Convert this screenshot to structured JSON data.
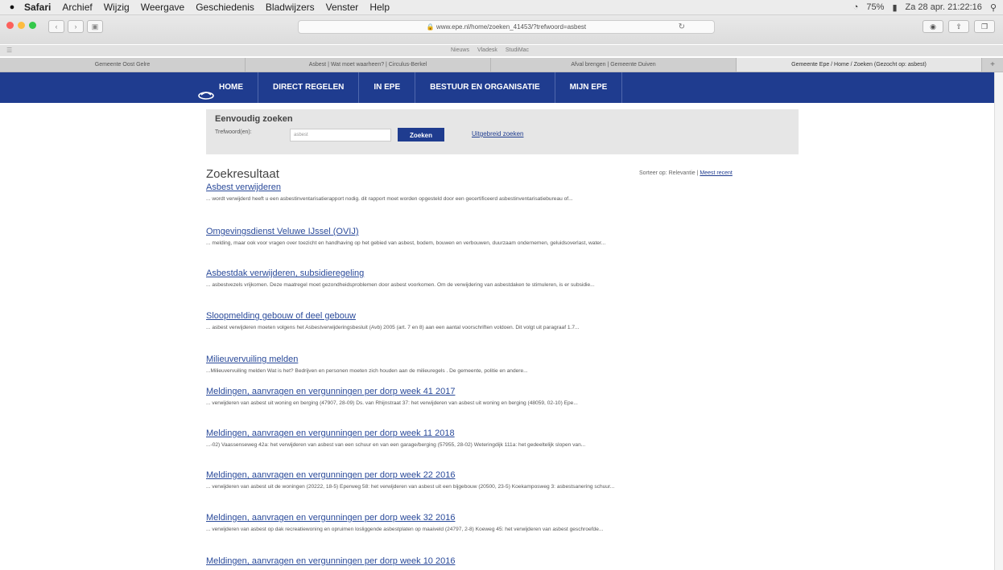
{
  "menubar": {
    "app": "Safari",
    "items": [
      "Archief",
      "Wijzig",
      "Weergave",
      "Geschiedenis",
      "Bladwijzers",
      "Venster",
      "Help"
    ],
    "battery": "75%",
    "clock": "Za 28 apr.  21:22:16"
  },
  "browser": {
    "url": "www.epe.nl/home/zoeken_41453/?trefwoord=asbest",
    "favorites": [
      "Nieuws",
      "Vladesk",
      "StudiMac"
    ],
    "tabs": [
      {
        "label": "Gemeente Oost Gelre",
        "active": false
      },
      {
        "label": "Asbest | Wat moet waarheen? | Circulus-Berkel",
        "active": false
      },
      {
        "label": "Afval brengen | Gemeente Duiven",
        "active": false
      },
      {
        "label": "Gemeente Epe / Home / Zoeken (Gezocht op: asbest)",
        "active": true
      }
    ]
  },
  "site_nav": {
    "items": [
      "HOME",
      "DIRECT REGELEN",
      "IN EPE",
      "BESTUUR EN ORGANISATIE",
      "MIJN EPE"
    ]
  },
  "search": {
    "title": "Eenvoudig zoeken",
    "label": "Trefwoord(en):",
    "value": "asbest",
    "button": "Zoeken",
    "advanced": "Uitgebreid zoeken"
  },
  "results": {
    "title": "Zoekresultaat",
    "sort_label": "Sorteer op: Relevantie |",
    "sort_recent": "Meest recent",
    "items": [
      {
        "title": "Asbest verwijderen",
        "desc": "... wordt verwijderd heeft u een asbestinventarisatierapport nodig. dit rapport moet worden opgesteld door een gecertificeerd asbestinventarisatiebureau of..."
      },
      {
        "title": "Omgevingsdienst Veluwe IJssel (OVIJ)",
        "desc": "... melding, maar ook voor vragen over toezicht en handhaving op het gebied van asbest, bodem, bouwen en verbouwen, duurzaam ondernemen, geluidsoverlast, water..."
      },
      {
        "title": "Asbestdak verwijderen, subsidieregeling",
        "desc": "... asbestvezels vrijkomen. Deze maatregel moet gezondheidsproblemen door asbest voorkomen. Om de verwijdering van asbestdaken te stimuleren, is er subsidie..."
      },
      {
        "title": "Sloopmelding gebouw of deel gebouw",
        "desc": "... asbest verwijderen moeten volgens het Asbestverwijderingsbesluit (Avb) 2005 (art. 7 en 8) aan een aantal voorschriften voldoen. Dit volgt uit paragraaf 1.7..."
      },
      {
        "title": "Milieuvervuiling melden",
        "desc": "...Milieuvervuiling melden Wat is het? Bedrijven en personen moeten zich houden aan de milieuregels . De gemeente, politie en andere..."
      },
      {
        "title": "Meldingen, aanvragen en vergunningen per dorp week 41 2017",
        "desc": "... verwijderen van asbest uit woning en berging (47907, 28-09) Ds. van Rhijnstraat 37: het verwijderen van asbest uit woning en berging (48059, 02-10) Epe..."
      },
      {
        "title": "Meldingen, aanvragen en vergunningen per dorp week 11 2018",
        "desc": "...-02) Vaassenseweg 42a: het verwijderen van asbest van een schuur en van een garage/berging (57955, 28-02) Weteringdijk 111a: het gedeeltelijk slopen van..."
      },
      {
        "title": "Meldingen, aanvragen en vergunningen per dorp week 22 2016",
        "desc": "... verwijderen van asbest uit de woningen (20222, 18-5) Eperweg 58: het verwijderen van asbest uit een bijgebouw (20500, 23-5) Koekamposweg 3: asbestsanering schuur..."
      },
      {
        "title": "Meldingen, aanvragen en vergunningen per dorp week 32 2016",
        "desc": "... verwijderen van asbest op dak recreatiewoning en opruimen losliggende asbestplaten op maaiveld (24797, 2-8) Koeweg 45: het verwijderen van asbest geschroefde..."
      },
      {
        "title": "Meldingen, aanvragen en vergunningen per dorp week 10 2016",
        "desc": ""
      }
    ]
  }
}
